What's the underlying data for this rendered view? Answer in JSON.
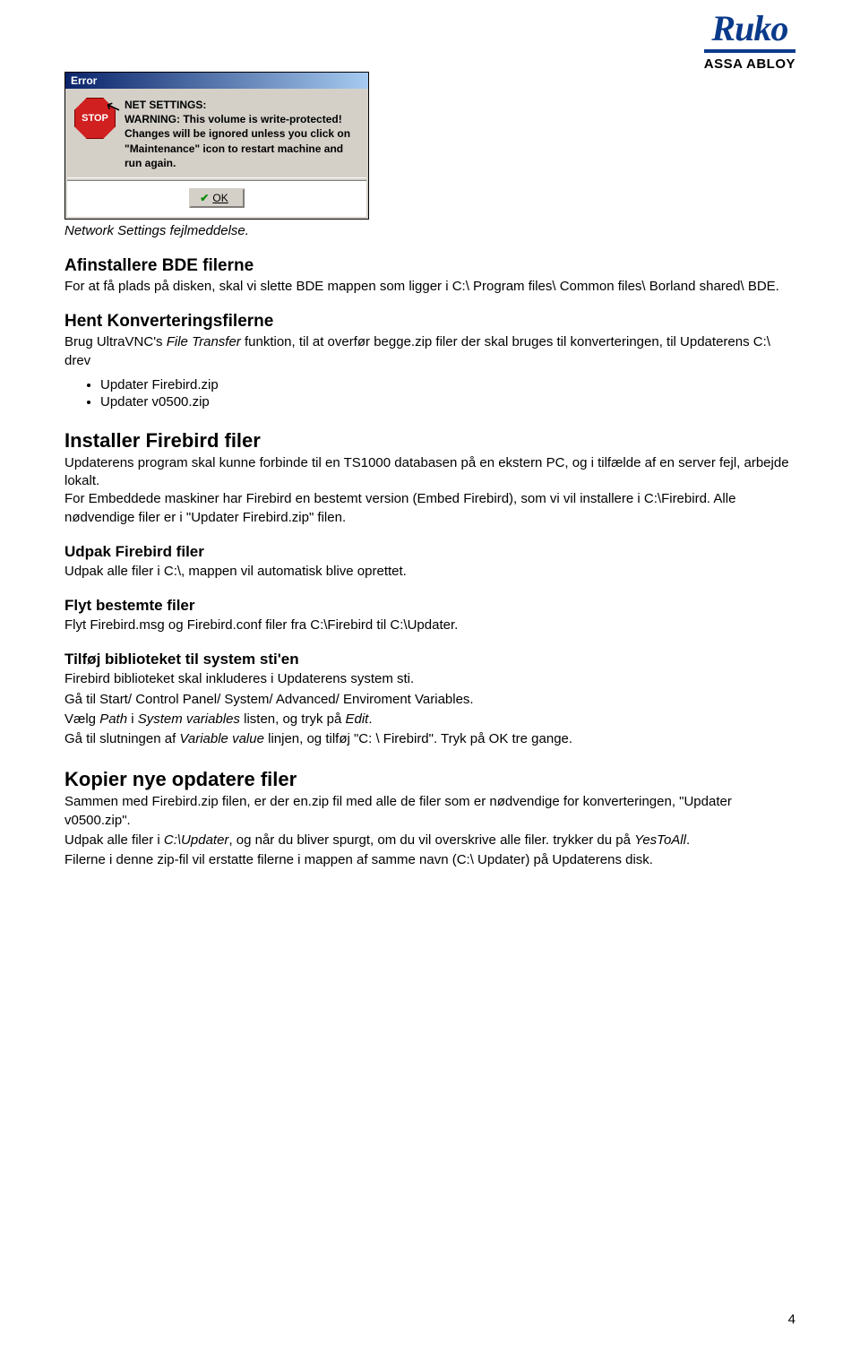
{
  "logo": {
    "brand": "Ruko",
    "sub": "ASSA ABLOY"
  },
  "dialog": {
    "title": "Error",
    "stop_label": "STOP",
    "message": "NET SETTINGS:\nWARNING: This volume is write-protected!\nChanges will be ignored unless you click on \"Maintenance\" icon to restart machine and run again.",
    "ok_label": "OK"
  },
  "caption": "Network Settings fejlmeddelse.",
  "sections": {
    "afinst_title": "Afinstallere BDE filerne",
    "afinst_body": "For at få plads på disken, skal vi slette BDE mappen som ligger i C:\\ Program files\\ Common files\\ Borland shared\\ BDE.",
    "hent_title": "Hent Konverteringsfilerne",
    "hent_body_a": "Brug UltraVNC's ",
    "hent_body_b_italic": "File Transfer",
    "hent_body_c": " funktion, til at overfør begge.zip filer der skal bruges til konverteringen, til Updaterens C:\\ drev",
    "bullets": [
      "Updater Firebird.zip",
      "Updater v0500.zip"
    ],
    "installer_title": "Installer Firebird filer",
    "installer_body": "Updaterens program skal kunne forbinde til en TS1000 databasen på en ekstern PC, og i tilfælde af en server fejl, arbejde lokalt.\nFor Embeddede maskiner har Firebird en bestemt version (Embed Firebird), som vi vil installere i C:\\Firebird. Alle nødvendige filer er i \"Updater Firebird.zip\" filen.",
    "udpak_title": "Udpak Firebird filer",
    "udpak_body": "Udpak alle filer i C:\\, mappen vil automatisk blive oprettet.",
    "flyt_title": "Flyt bestemte filer",
    "flyt_body": "Flyt Firebird.msg og Firebird.conf filer fra C:\\Firebird til C:\\Updater.",
    "tilfoj_title": "Tilføj biblioteket til system sti'en",
    "tilfoj_l1": "Firebird biblioteket skal inkluderes i Updaterens system sti.",
    "tilfoj_l2": "Gå til Start/ Control Panel/ System/ Advanced/ Enviroment Variables.",
    "tilfoj_l3a": "Vælg ",
    "tilfoj_l3b_i": "Path",
    "tilfoj_l3c": " i ",
    "tilfoj_l3d_i": "System variables",
    "tilfoj_l3e": " listen, og tryk på ",
    "tilfoj_l3f_i": "Edit",
    "tilfoj_l3g": ".",
    "tilfoj_l4a": "Gå til slutningen af ",
    "tilfoj_l4b_i": "Variable value",
    "tilfoj_l4c": " linjen, og tilføj \"C: \\ Firebird\". Tryk på OK tre gange.",
    "kopier_title": "Kopier nye opdatere filer",
    "kopier_l1": "Sammen med Firebird.zip filen, er der en.zip fil med alle de filer som er nødvendige for konverteringen, \"Updater v0500.zip\".",
    "kopier_l2a": "Udpak alle filer i ",
    "kopier_l2b_i": "C:\\Updater",
    "kopier_l2c": ", og når du bliver spurgt, om du vil overskrive alle filer. trykker du på ",
    "kopier_l2d_i": "YesToAll",
    "kopier_l2e": ".",
    "kopier_l3": "Filerne i denne zip-fil vil erstatte filerne i mappen af samme navn (C:\\ Updater) på Updaterens disk."
  },
  "page_number": "4"
}
